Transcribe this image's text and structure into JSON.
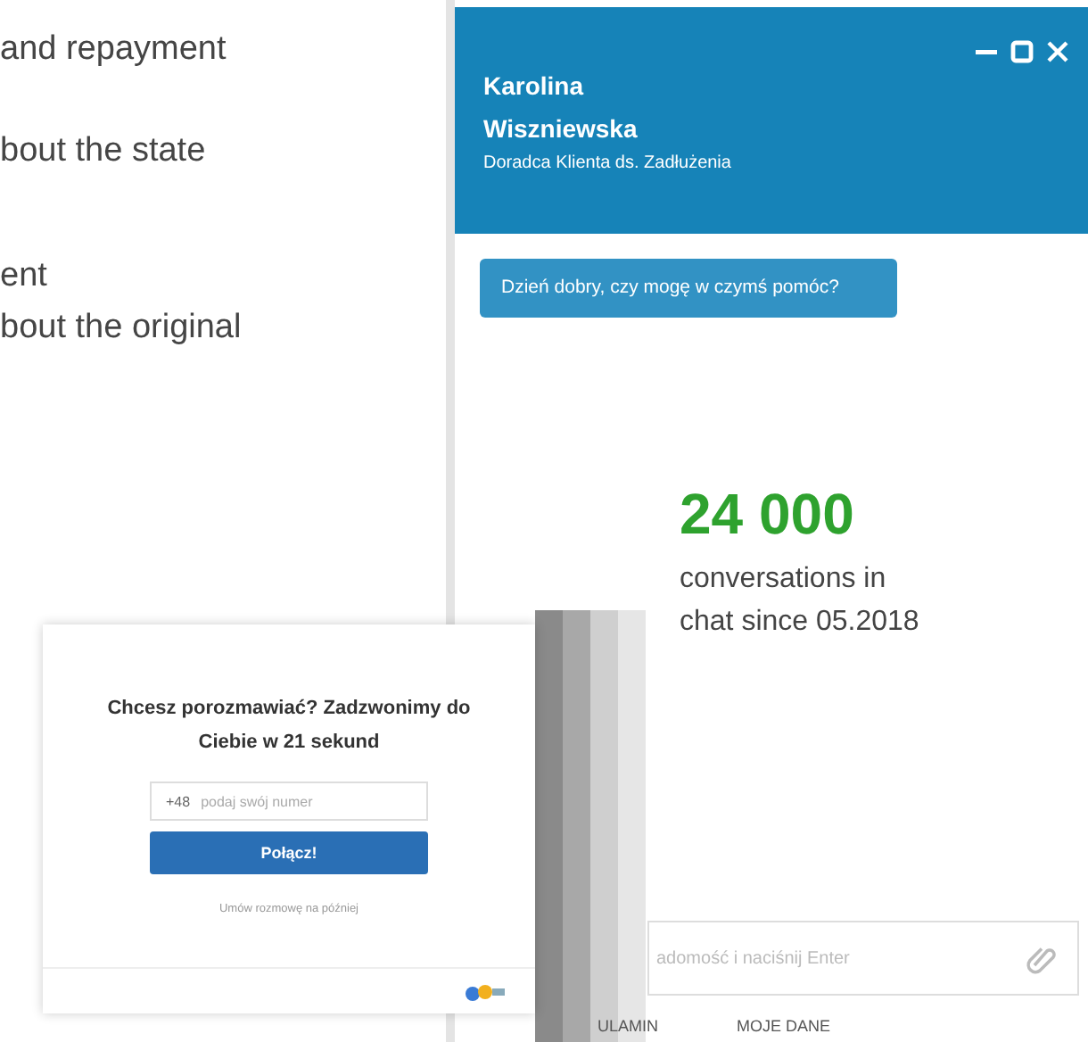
{
  "article_lines": [
    "and repayment",
    "bout the state",
    "ent",
    "bout the original"
  ],
  "chat": {
    "agent_name": "Karolina Wiszniewska",
    "agent_role": "Doradca Klienta ds. Zadłużenia",
    "messages": [
      "Dzień dobry, czy mogę w czymś pomóc?"
    ],
    "input": {
      "placeholder": "adomość i naciśnij Enter"
    },
    "tabs": [
      {
        "label": "ULAMIN"
      },
      {
        "label": "MOJE DANE"
      }
    ]
  },
  "stat": {
    "value": "24 000",
    "caption": "conversations in chat since 05.2018"
  },
  "callback_popup": {
    "title": "Chcesz porozmawiać? Zadzwonimy do Ciebie w 21 sekund",
    "prefix": "+48",
    "placeholder": "podaj swój numer",
    "button": "Połącz!",
    "link": "Umów rozmowę na później"
  }
}
